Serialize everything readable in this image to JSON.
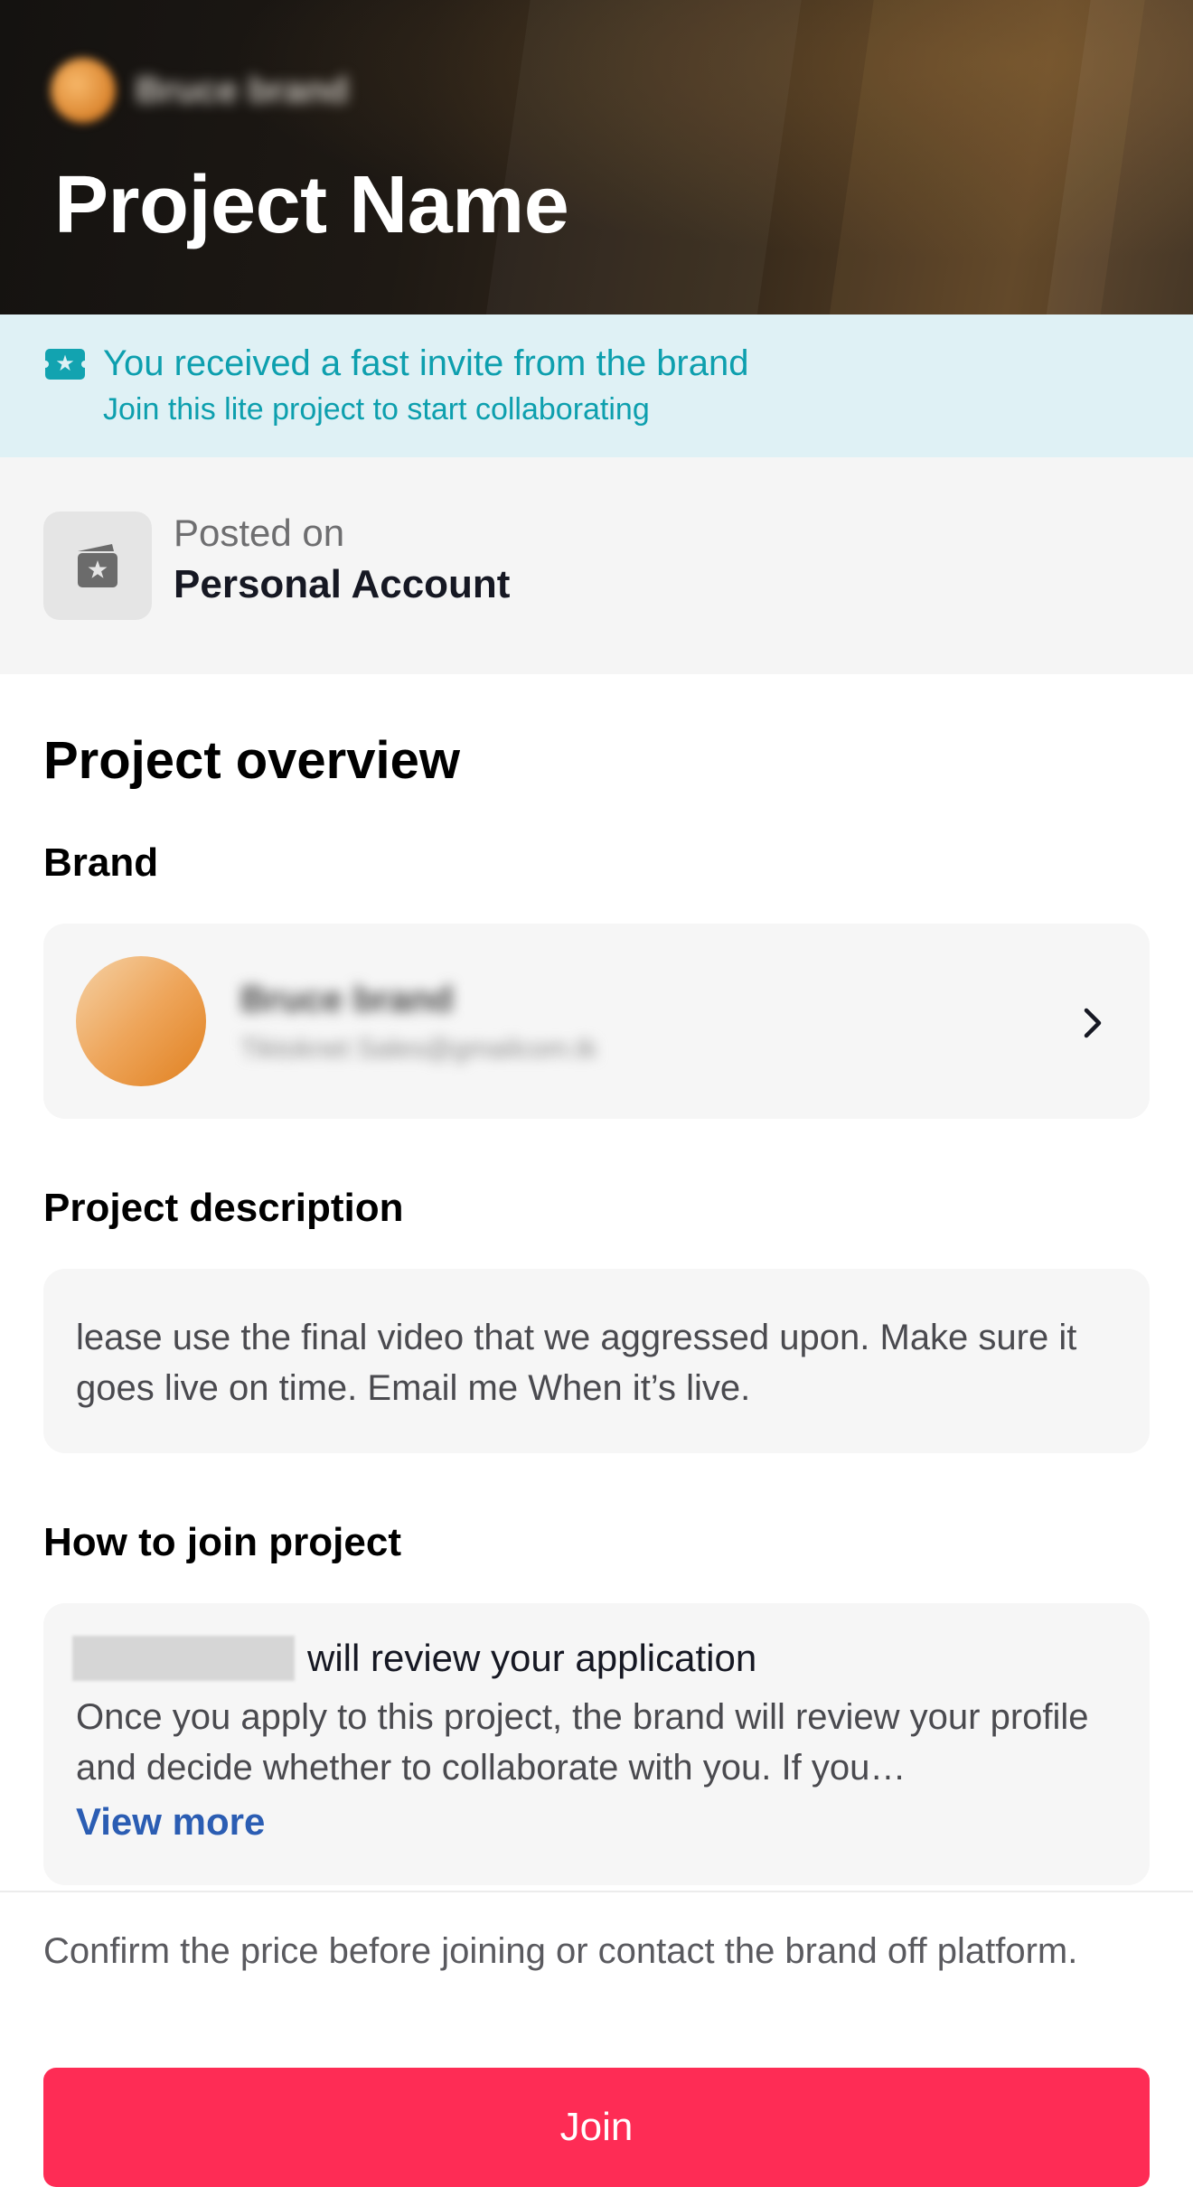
{
  "header": {
    "brand_name": "Bruce brand",
    "title": "Project Name"
  },
  "invite_banner": {
    "title": "You received a fast invite from the brand",
    "subtitle": "Join this lite project to start collaborating",
    "icon": "ticket-star-icon",
    "color": "#0d9fae"
  },
  "posted": {
    "label": "Posted on",
    "value": "Personal Account",
    "icon": "calendar-star-icon"
  },
  "overview": {
    "heading": "Project overview",
    "brand": {
      "label": "Brand",
      "name": "Bruce brand",
      "handle": "Tiktoknet Sales@gmailcom.tk"
    },
    "description": {
      "label": "Project description",
      "text": "lease use the final video that we aggressed upon. Make sure it goes live on time. Email me When it’s live."
    },
    "how_to_join": {
      "label": "How to join project",
      "title": "will review your application",
      "body": "Once you apply to this project, the brand will review your profile and decide whether to collaborate with you. If you…",
      "view_more": "View more"
    }
  },
  "footer": {
    "note": "Confirm the price before joining or contact the brand off platform.",
    "join_label": "Join",
    "accent_color": "#fe2c55"
  }
}
